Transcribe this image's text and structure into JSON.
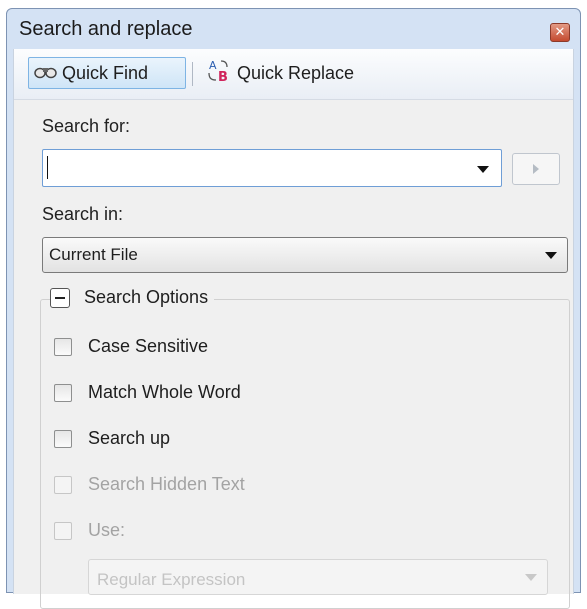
{
  "window": {
    "title": "Search and replace",
    "close_glyph": "✕"
  },
  "toolbar": {
    "quick_find": {
      "label": "Quick Find",
      "icon": "binoculars-icon"
    },
    "quick_replace": {
      "label": "Quick Replace",
      "icon": "ab-replace-icon"
    }
  },
  "search_for": {
    "label": "Search for:",
    "value": ""
  },
  "search_in": {
    "label": "Search in:",
    "value": "Current File"
  },
  "options": {
    "title": "Search Options",
    "items": [
      {
        "label": "Case Sensitive"
      },
      {
        "label": "Match Whole Word"
      },
      {
        "label": "Search up"
      },
      {
        "label": "Search Hidden Text"
      },
      {
        "label": "Use:"
      }
    ],
    "use_value": "Regular Expression"
  },
  "colors": {
    "accent": "#7eb4e4",
    "frame": "#d4e2f4",
    "close": "#c44a2f"
  }
}
